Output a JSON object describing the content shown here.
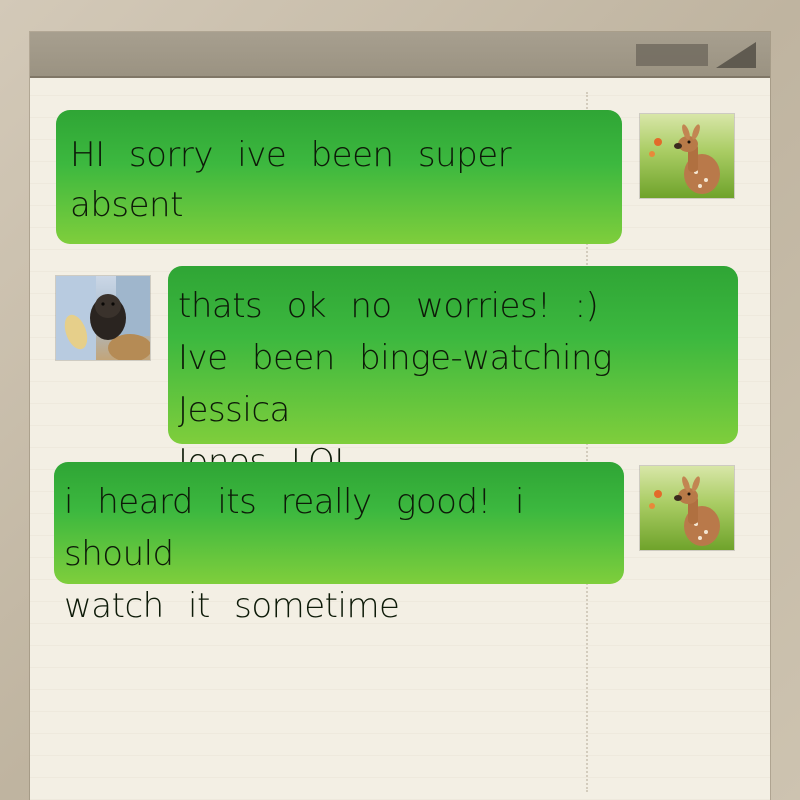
{
  "messages": [
    {
      "sender": "deer",
      "lines": [
        "HI sorry ive been super",
        "absent"
      ]
    },
    {
      "sender": "ferret",
      "lines": [
        "thats ok no worries! :)",
        "Ive been binge-watching Jessica",
        "Jones LOL"
      ]
    },
    {
      "sender": "deer",
      "lines": [
        "i heard its really good! i should",
        "watch it sometime"
      ]
    }
  ],
  "avatars": {
    "deer": "deer-avatar",
    "ferret": "ferret-avatar"
  },
  "colors": {
    "bubble_top": "#2fa535",
    "bubble_bottom": "#7fce3c",
    "paper": "#f3efe4",
    "title_bar": "#a79f8f"
  }
}
